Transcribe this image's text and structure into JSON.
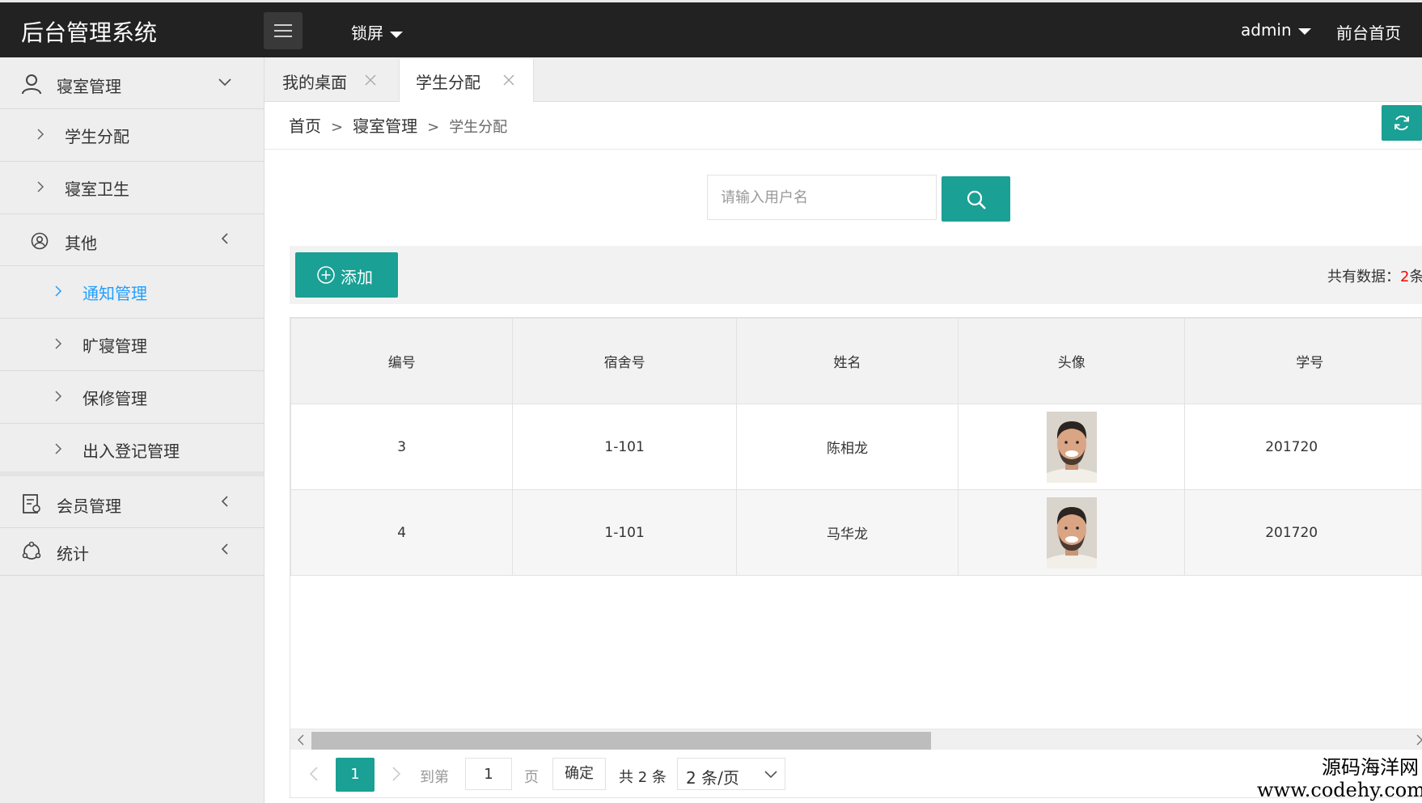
{
  "header": {
    "logo": "后台管理系统",
    "lock_label": "锁屏",
    "user_label": "admin",
    "front_label": "前台首页"
  },
  "sidebar": {
    "groups": [
      {
        "label": "寝室管理",
        "icon": "user-icon",
        "expanded": true,
        "items": [
          {
            "label": "学生分配"
          },
          {
            "label": "寝室卫生"
          }
        ]
      },
      {
        "label": "其他",
        "icon": "user-circle-icon",
        "expanded": true,
        "items": [
          {
            "label": "通知管理",
            "active": true
          },
          {
            "label": "旷寝管理"
          },
          {
            "label": "保修管理"
          },
          {
            "label": "出入登记管理"
          }
        ]
      },
      {
        "label": "会员管理",
        "icon": "member-card-icon",
        "expanded": false,
        "items": []
      },
      {
        "label": "统计",
        "icon": "stats-icon",
        "expanded": false,
        "items": []
      }
    ]
  },
  "tabs": [
    {
      "label": "我的桌面",
      "active": false
    },
    {
      "label": "学生分配",
      "active": true
    }
  ],
  "breadcrumb": {
    "home": "首页",
    "sep": ">",
    "section": "寝室管理",
    "current": "学生分配"
  },
  "search": {
    "placeholder": "请输入用户名"
  },
  "toolbar": {
    "add_label": "添加",
    "total_prefix": "共有数据：",
    "total_count": "2",
    "total_suffix": "条"
  },
  "table": {
    "columns": [
      "编号",
      "宿舍号",
      "姓名",
      "头像",
      "学号"
    ],
    "rows": [
      {
        "id": "3",
        "room": "1-101",
        "name": "陈相龙",
        "student_no": "201720"
      },
      {
        "id": "4",
        "room": "1-101",
        "name": "马华龙",
        "student_no": "201720"
      }
    ]
  },
  "pagination": {
    "current_page": "1",
    "goto_label": "到第",
    "page_input": "1",
    "page_unit": "页",
    "confirm_label": "确定",
    "total_label": "共 2 条",
    "page_size": "2 条/页"
  },
  "watermark": {
    "line1": "源码海洋网",
    "line2": "www.codehy.com"
  },
  "colors": {
    "header_bg": "#222222",
    "accent": "#1aa094",
    "active_link": "#1e9fff",
    "count_red": "#ff0000"
  }
}
